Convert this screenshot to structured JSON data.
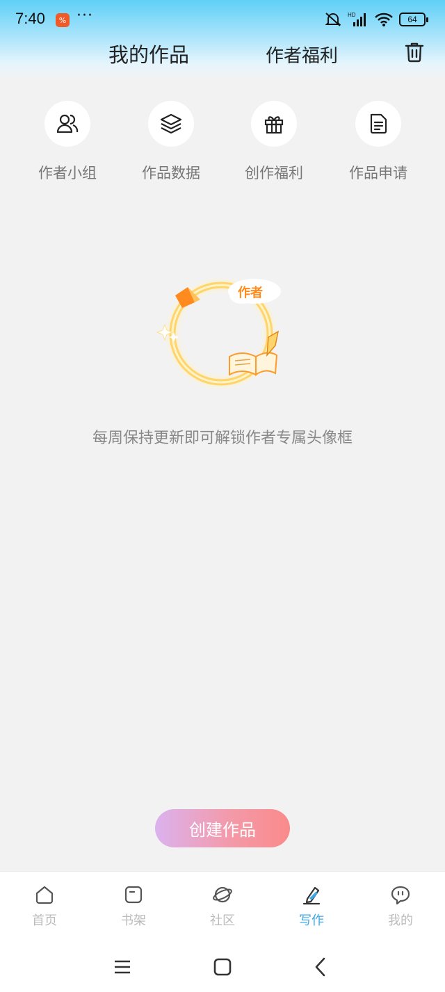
{
  "status_bar": {
    "time": "7:40",
    "app_badge": "%",
    "more": "···",
    "network": "HD",
    "battery": "64"
  },
  "header": {
    "tab_works": "我的作品",
    "tab_benefit": "作者福利",
    "trash_icon": "trash-icon"
  },
  "shortcuts": [
    {
      "label": "作者小组",
      "icon": "users-icon"
    },
    {
      "label": "作品数据",
      "icon": "layers-icon"
    },
    {
      "label": "创作福利",
      "icon": "gift-icon"
    },
    {
      "label": "作品申请",
      "icon": "document-icon"
    }
  ],
  "empty_state": {
    "badge_text": "作者",
    "message": "每周保持更新即可解锁作者专属头像框"
  },
  "create_button": "创建作品",
  "bottom_nav": [
    {
      "label": "首页",
      "icon": "home-icon",
      "active": false
    },
    {
      "label": "书架",
      "icon": "bookshelf-icon",
      "active": false
    },
    {
      "label": "社区",
      "icon": "planet-icon",
      "active": false
    },
    {
      "label": "写作",
      "icon": "pen-icon",
      "active": true
    },
    {
      "label": "我的",
      "icon": "chat-icon",
      "active": false
    }
  ],
  "colors": {
    "accent": "#3ea8e6",
    "header_gradient_top": "#5fd0f7",
    "button_gradient_start": "#dbb2ef",
    "button_gradient_end": "#fa8a8a"
  }
}
